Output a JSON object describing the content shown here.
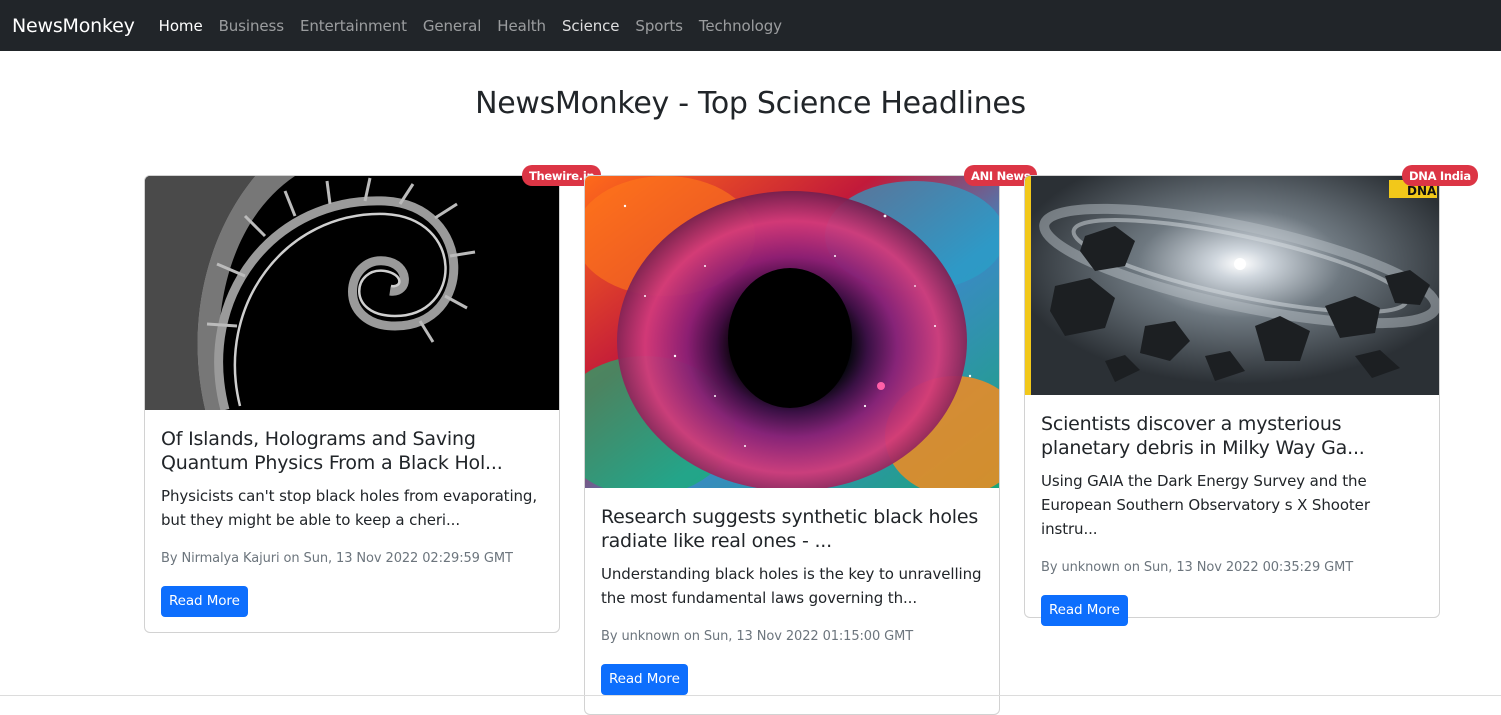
{
  "navbar": {
    "brand": "NewsMonkey",
    "links": [
      "Home",
      "Business",
      "Entertainment",
      "General",
      "Health",
      "Science",
      "Sports",
      "Technology"
    ]
  },
  "page": {
    "title": "NewsMonkey - Top Science Headlines"
  },
  "articles": [
    {
      "source": "Thewire.in",
      "title": "Of Islands, Holograms and Saving Quantum Physics From a Black Hol...",
      "description": "Physicists can't stop black holes from evaporating, but they might be able to keep a cheri...",
      "meta": "By Nirmalya Kajuri on Sun, 13 Nov 2022 02:29:59 GMT",
      "button": "Read More",
      "image": "spiral-fractal-image"
    },
    {
      "source": "ANI News",
      "title": "Research suggests synthetic black holes radiate like real ones - ...",
      "description": "Understanding black holes is the key to unravelling the most fundamental laws governing th...",
      "meta": "By unknown on Sun, 13 Nov 2022 01:15:00 GMT",
      "button": "Read More",
      "image": "black-hole-nebula-image"
    },
    {
      "source": "DNA India",
      "title": "Scientists discover a mysterious planetary debris in Milky Way Ga...",
      "description": "Using GAIA the Dark Energy Survey and the European Southern Observatory s X Shooter instru...",
      "meta": "By unknown on Sun, 13 Nov 2022 00:35:29 GMT",
      "button": "Read More",
      "image": "planetary-debris-image",
      "image_logo": "DNA"
    }
  ],
  "colors": {
    "navbar_bg": "#212529",
    "badge": "#dc3545",
    "button": "#0d6efd",
    "meta_text": "#6c757d"
  }
}
